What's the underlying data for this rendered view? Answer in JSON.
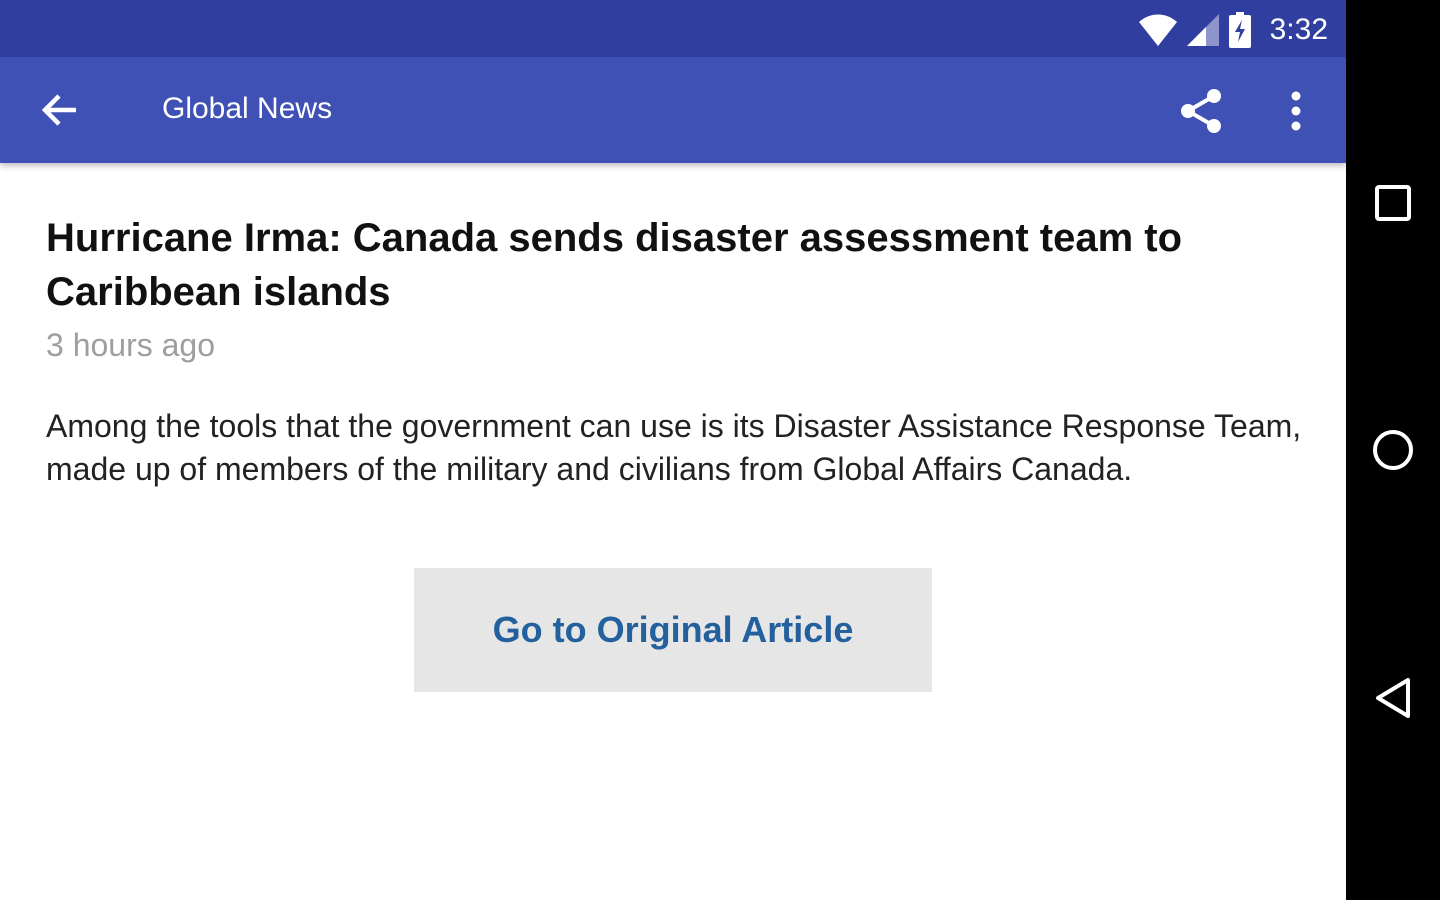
{
  "status_bar": {
    "time": "3:32",
    "icons": [
      "wifi-icon",
      "cell-signal-icon",
      "battery-charging-icon"
    ]
  },
  "toolbar": {
    "title": "Global News",
    "back_icon": "arrow-back-icon",
    "share_icon": "share-icon",
    "more_icon": "more-vert-icon"
  },
  "article": {
    "headline": "Hurricane Irma: Canada sends disaster assessment team to Caribbean islands",
    "time_ago": "3 hours ago",
    "summary": "Among the tools that the government can use is its Disaster Assistance Response Team, made up of members of the military and civilians from Global Affairs Canada.",
    "button_label": "Go to Original Article"
  },
  "nav_bar": {
    "buttons": [
      "recents-square-icon",
      "home-circle-icon",
      "back-triangle-icon"
    ]
  },
  "colors": {
    "status_bar": "#303f9f",
    "toolbar": "#3f51b5",
    "button_bg": "#e6e6e6",
    "button_text": "#23609e",
    "timestamp": "#9e9e9e"
  }
}
